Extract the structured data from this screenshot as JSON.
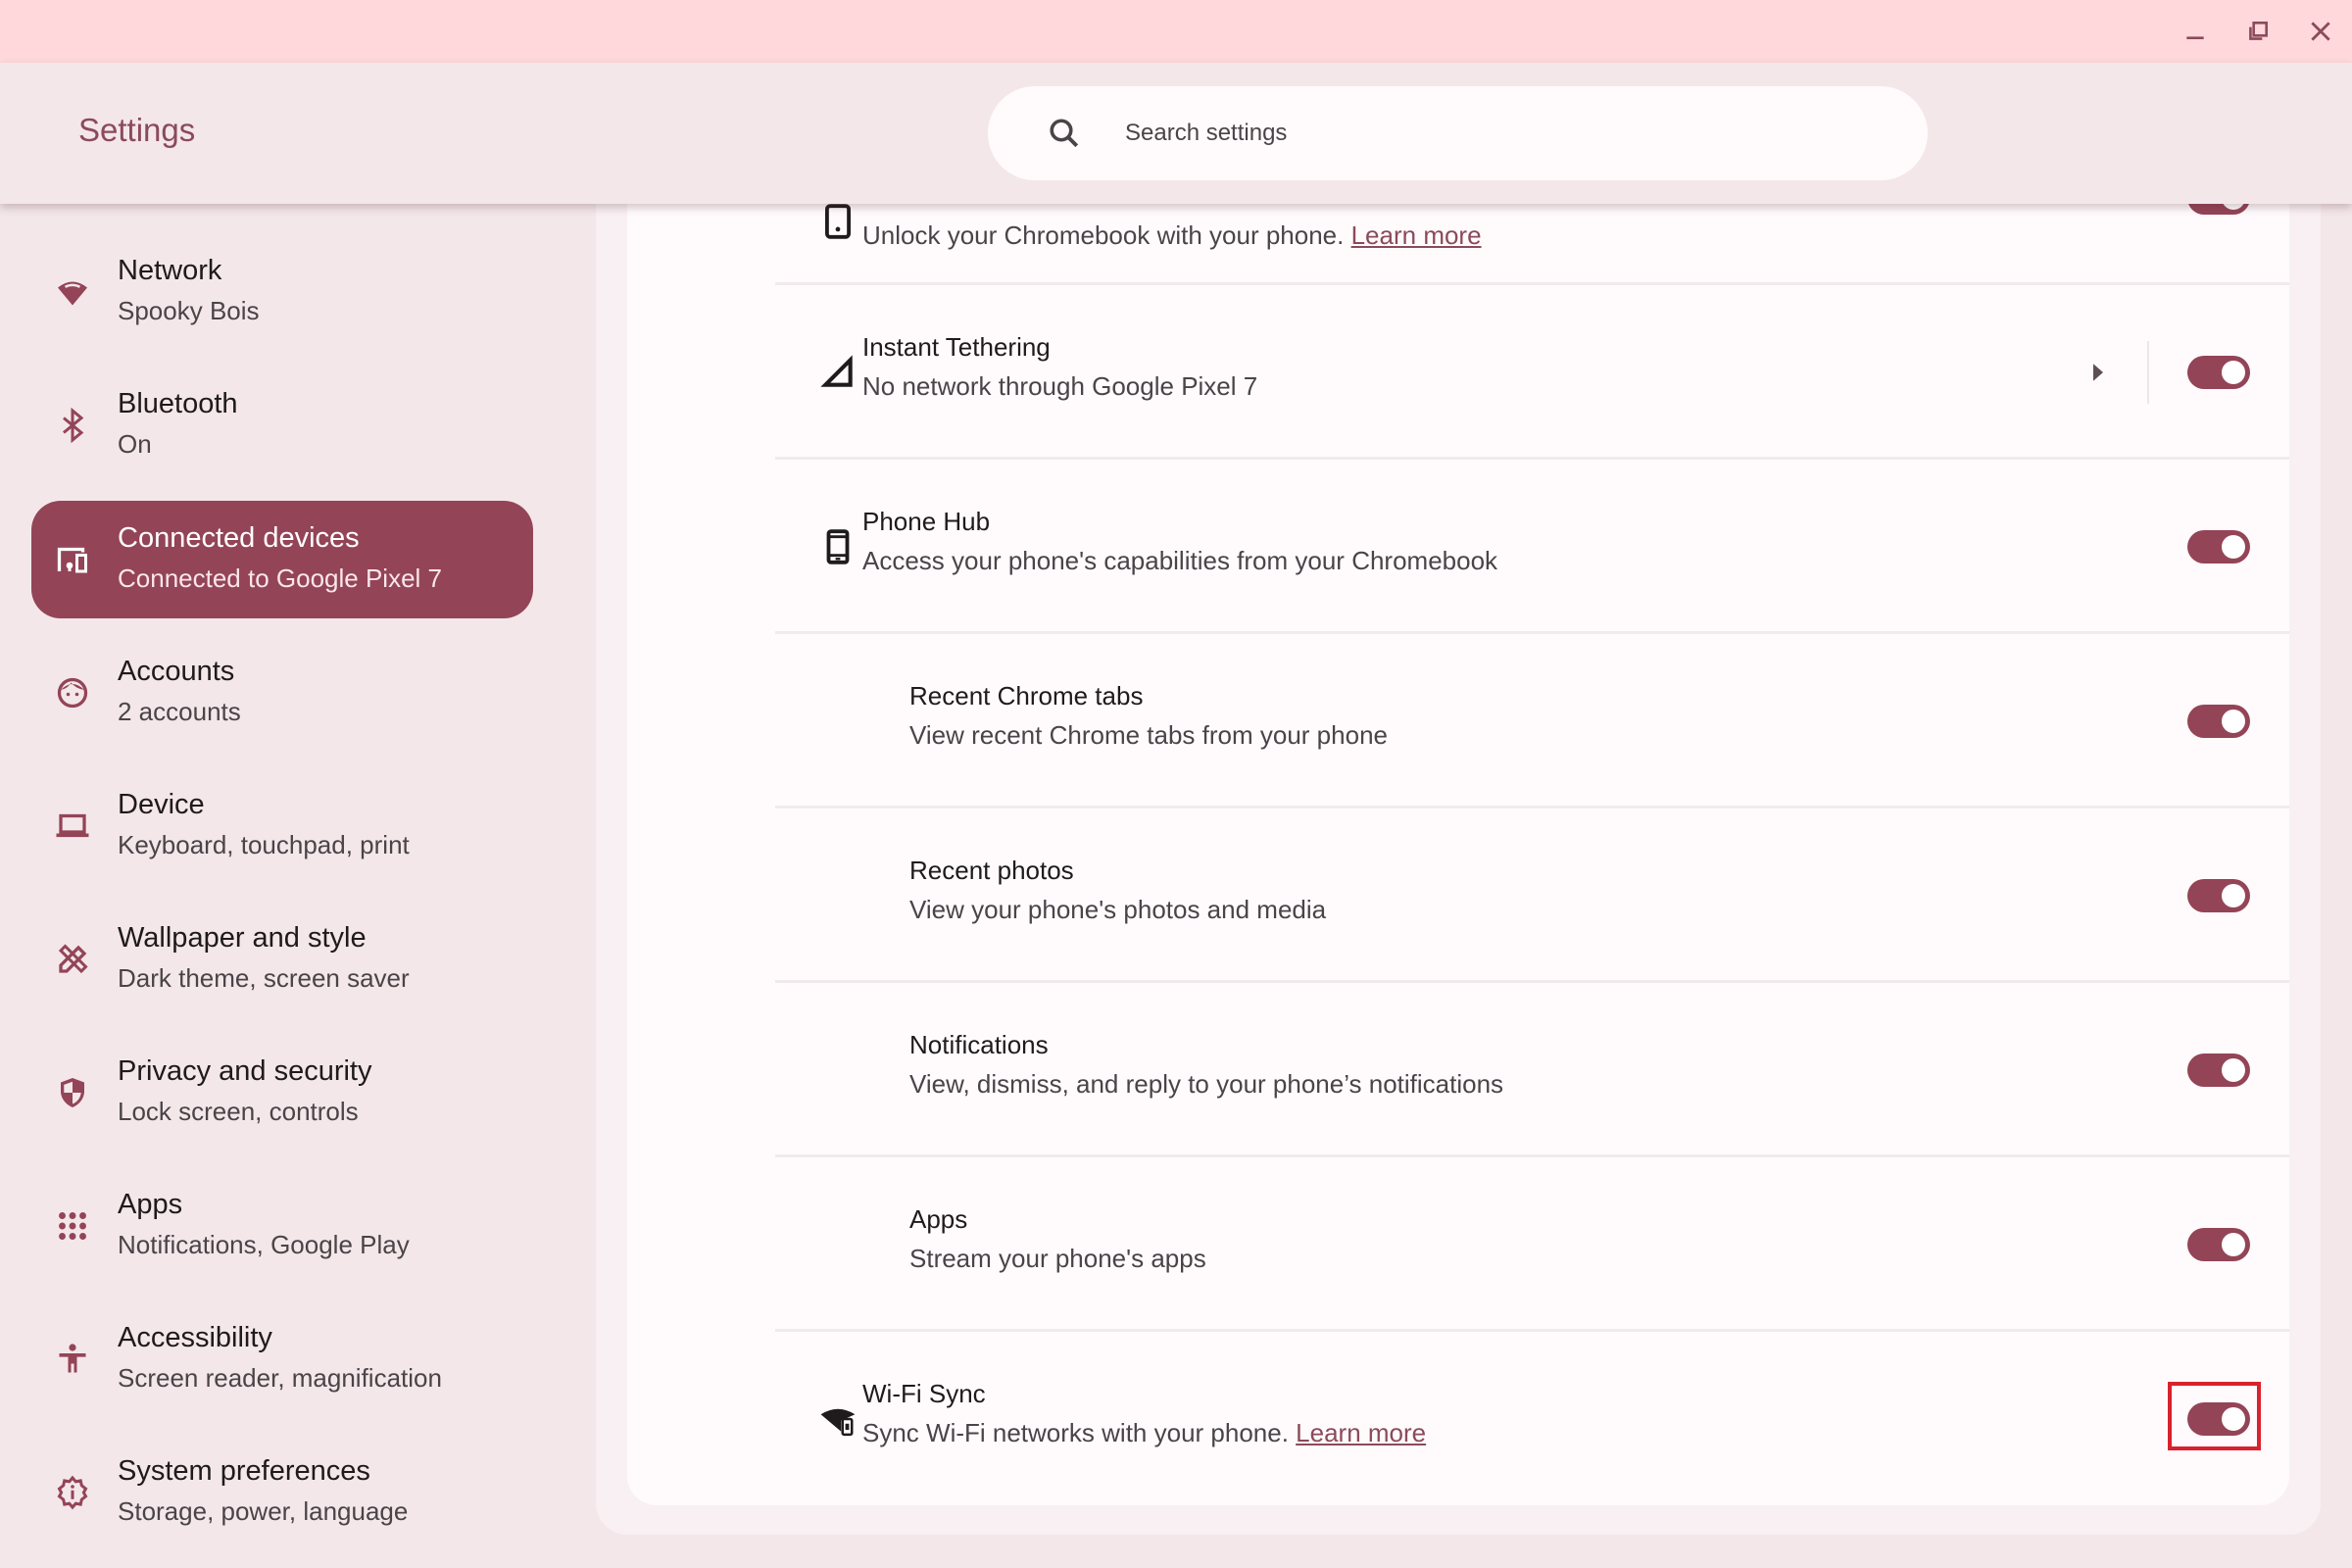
{
  "window": {
    "controls": [
      {
        "name": "minimize-button",
        "icon": "minimize-icon"
      },
      {
        "name": "restore-button",
        "icon": "restore-icon"
      },
      {
        "name": "close-button",
        "icon": "close-icon"
      }
    ]
  },
  "header": {
    "title": "Settings",
    "search": {
      "placeholder": "Search settings",
      "value": "",
      "icon": "search-icon"
    }
  },
  "sidebar": {
    "selected_index": 2,
    "items": [
      {
        "label": "Network",
        "sublabel": "Spooky Bois",
        "icon": "wifi-icon"
      },
      {
        "label": "Bluetooth",
        "sublabel": "On",
        "icon": "bluetooth-icon"
      },
      {
        "label": "Connected devices",
        "sublabel": "Connected to Google Pixel 7",
        "icon": "connected-devices-icon"
      },
      {
        "label": "Accounts",
        "sublabel": "2 accounts",
        "icon": "account-face-icon"
      },
      {
        "label": "Device",
        "sublabel": "Keyboard, touchpad, print",
        "icon": "laptop-icon"
      },
      {
        "label": "Wallpaper and style",
        "sublabel": "Dark theme, screen saver",
        "icon": "palette-pencil-icon"
      },
      {
        "label": "Privacy and security",
        "sublabel": "Lock screen, controls",
        "icon": "shield-icon"
      },
      {
        "label": "Apps",
        "sublabel": "Notifications, Google Play",
        "icon": "apps-grid-icon"
      },
      {
        "label": "Accessibility",
        "sublabel": "Screen reader, magnification",
        "icon": "accessibility-icon"
      },
      {
        "label": "System preferences",
        "sublabel": "Storage, power, language",
        "icon": "system-gear-icon"
      }
    ]
  },
  "content": {
    "rows": [
      {
        "title": "",
        "subtitle": "Unlock your Chromebook with your phone.",
        "link": "Learn more",
        "icon": "smart-lock-icon",
        "toggle_on": true,
        "partially_hidden": true
      },
      {
        "title": "Instant Tethering",
        "subtitle": "No network through Google Pixel 7",
        "icon": "signal-icon",
        "has_arrow": true,
        "toggle_on": true
      },
      {
        "title": "Phone Hub",
        "subtitle": "Access your phone's capabilities from your Chromebook",
        "icon": "phone-icon",
        "toggle_on": true
      },
      {
        "title": "Recent Chrome tabs",
        "subtitle": "View recent Chrome tabs from your phone",
        "toggle_on": true,
        "indented": true
      },
      {
        "title": "Recent photos",
        "subtitle": "View your phone's photos and media",
        "toggle_on": true,
        "indented": true
      },
      {
        "title": "Notifications",
        "subtitle": "View, dismiss, and reply to your phone’s notifications",
        "toggle_on": true,
        "indented": true
      },
      {
        "title": "Apps",
        "subtitle": "Stream your phone's apps",
        "toggle_on": true,
        "indented": true
      },
      {
        "title": "Wi-Fi Sync",
        "subtitle": "Sync Wi-Fi networks with your phone.",
        "link": "Learn more",
        "icon": "wifi-sync-icon",
        "toggle_on": true,
        "highlighted": true
      }
    ]
  },
  "colors": {
    "accent": "#944457",
    "title_bar": "#ffd8dc",
    "surface": "#f3e7ea",
    "card": "#fffbfd",
    "highlight": "#d9222e",
    "link": "#8b4a5a"
  }
}
